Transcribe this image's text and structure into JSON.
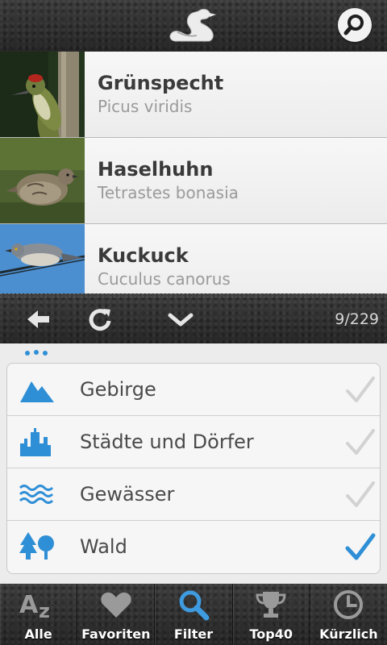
{
  "header": {
    "logo_icon": "swan-icon",
    "search_icon": "search-icon"
  },
  "birds": [
    {
      "name": "Grünspecht",
      "latin": "Picus viridis"
    },
    {
      "name": "Haselhuhn",
      "latin": "Tetrastes bonasia"
    },
    {
      "name": "Kuckuck",
      "latin": "Cuculus canorus"
    }
  ],
  "nav": {
    "back_icon": "arrow-left-icon",
    "refresh_icon": "refresh-icon",
    "collapse_icon": "chevron-down-icon",
    "counter": "9/229"
  },
  "filters": [
    {
      "label": "Gebirge",
      "icon": "mountain-icon",
      "checked": false
    },
    {
      "label": "Städte und Dörfer",
      "icon": "city-icon",
      "checked": false
    },
    {
      "label": "Gewässer",
      "icon": "water-icon",
      "checked": false
    },
    {
      "label": "Wald",
      "icon": "forest-icon",
      "checked": true
    }
  ],
  "tabs": [
    {
      "label": "Alle",
      "icon": "az-icon"
    },
    {
      "label": "Favoriten",
      "icon": "heart-icon"
    },
    {
      "label": "Filter",
      "icon": "magnifier-icon",
      "active": true
    },
    {
      "label": "Top40",
      "icon": "trophy-icon"
    },
    {
      "label": "Kürzlich",
      "icon": "clock-icon"
    }
  ],
  "colors": {
    "accent": "#2f8fd6",
    "leather": "#2f2f2f",
    "check_inactive": "#cfcfcf"
  }
}
